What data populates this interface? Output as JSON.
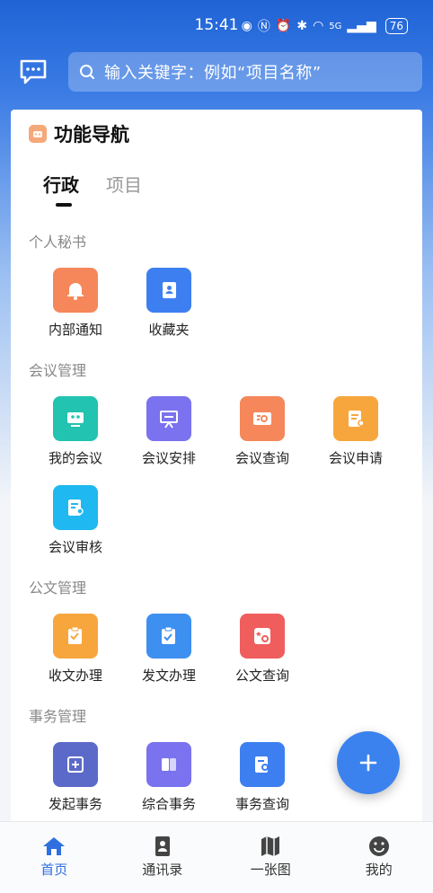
{
  "status_bar": {
    "time": "15:41",
    "network": "5G",
    "battery": "76"
  },
  "search": {
    "placeholder": "输入关键字：例如“项目名称”"
  },
  "panel": {
    "title": "功能导航",
    "tabs": [
      {
        "label": "行政",
        "active": true
      },
      {
        "label": "项目",
        "active": false
      }
    ]
  },
  "sections": [
    {
      "title": "个人秘书",
      "items": [
        {
          "label": "内部通知",
          "icon": "bell-icon",
          "color": "#f5875a"
        },
        {
          "label": "收藏夹",
          "icon": "contact-book-icon",
          "color": "#3d7ff0"
        }
      ]
    },
    {
      "title": "会议管理",
      "items": [
        {
          "label": "我的会议",
          "icon": "meeting-room-icon",
          "color": "#22c3b0"
        },
        {
          "label": "会议安排",
          "icon": "presentation-board-icon",
          "color": "#7a72ee"
        },
        {
          "label": "会议查询",
          "icon": "meeting-search-icon",
          "color": "#f5875a"
        },
        {
          "label": "会议申请",
          "icon": "meeting-apply-icon",
          "color": "#f7a63d"
        },
        {
          "label": "会议审核",
          "icon": "meeting-review-icon",
          "color": "#1fb8f0"
        }
      ]
    },
    {
      "title": "公文管理",
      "items": [
        {
          "label": "收文办理",
          "icon": "doc-receive-icon",
          "color": "#f7a63d"
        },
        {
          "label": "发文办理",
          "icon": "doc-send-icon",
          "color": "#3d8ff0"
        },
        {
          "label": "公文查询",
          "icon": "doc-search-icon",
          "color": "#ef5d5d"
        }
      ]
    },
    {
      "title": "事务管理",
      "items": [
        {
          "label": "发起事务",
          "icon": "add-task-icon",
          "color": "#5b6ac9"
        },
        {
          "label": "综合事务",
          "icon": "general-affairs-icon",
          "color": "#7a72ee"
        },
        {
          "label": "事务查询",
          "icon": "task-search-icon",
          "color": "#3d7ff0"
        }
      ]
    }
  ],
  "bottom_nav": [
    {
      "label": "首页",
      "active": true
    },
    {
      "label": "通讯录",
      "active": false
    },
    {
      "label": "一张图",
      "active": false
    },
    {
      "label": "我的",
      "active": false
    }
  ],
  "colors": {
    "primary": "#2f6fe0",
    "fab": "#3b82ee"
  }
}
